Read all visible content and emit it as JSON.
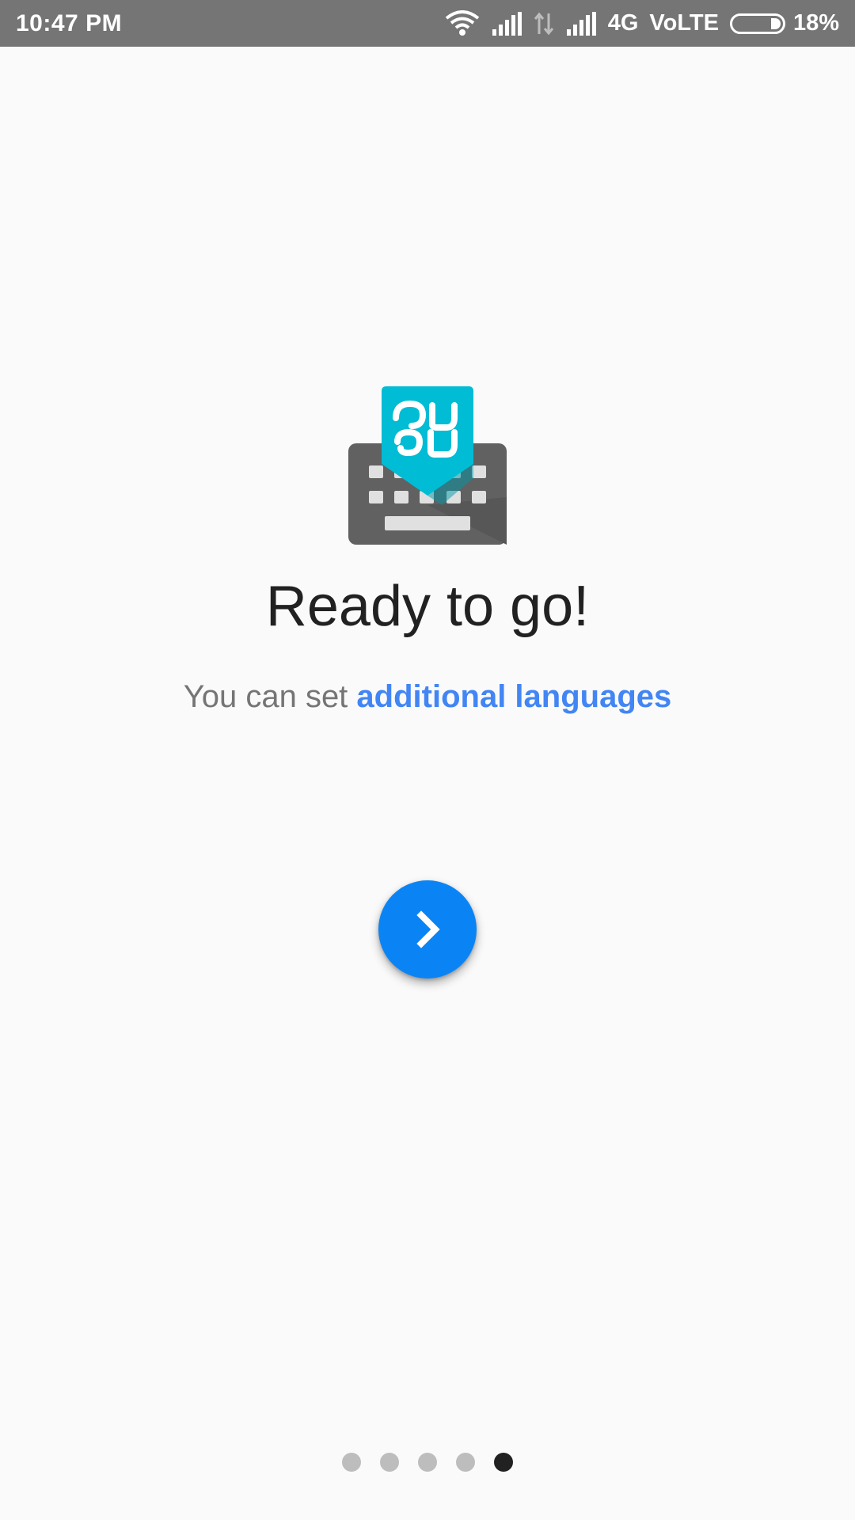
{
  "status_bar": {
    "time": "10:47 PM",
    "network": "4G",
    "volte": "VoLTE",
    "battery": "18%",
    "icons": [
      "wifi-icon",
      "signal-icon",
      "data-arrows-icon",
      "signal-icon",
      "battery-icon"
    ]
  },
  "logo": {
    "icon": "gboard-indic-keyboard-icon",
    "colors": {
      "keyboard": "#616161",
      "tag": "#00bcd4",
      "keys": "#e0e0e0"
    }
  },
  "main": {
    "title": "Ready to go!",
    "subtitle_prefix": "You can set ",
    "subtitle_link": "additional languages"
  },
  "next_button": {
    "icon": "chevron-right-icon",
    "color": "#0a84f5"
  },
  "pager": {
    "total": 5,
    "current": 5
  },
  "colors": {
    "accent": "#4285f4",
    "status_bar": "#757575",
    "background": "#fafafa"
  }
}
